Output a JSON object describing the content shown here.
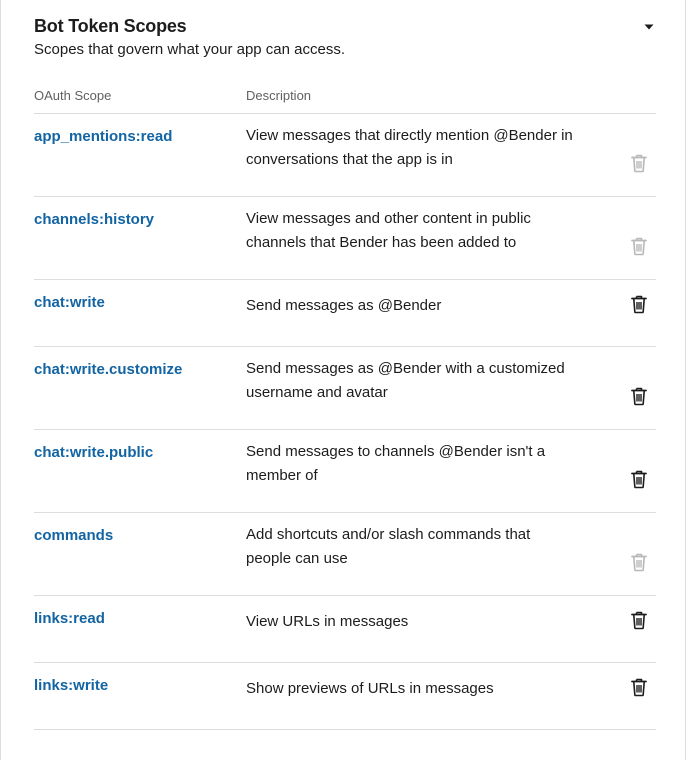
{
  "section": {
    "title": "Bot Token Scopes",
    "subtitle": "Scopes that govern what your app can access."
  },
  "table": {
    "headers": {
      "scope": "OAuth Scope",
      "description": "Description"
    },
    "rows": [
      {
        "scope": "app_mentions:read",
        "description": "View messages that directly mention @Bender in conversations that the app is in",
        "delete_enabled": false
      },
      {
        "scope": "channels:history",
        "description": "View messages and other content in public channels that Bender has been added to",
        "delete_enabled": false
      },
      {
        "scope": "chat:write",
        "description": "Send messages as @Bender",
        "delete_enabled": true
      },
      {
        "scope": "chat:write.customize",
        "description": "Send messages as @Bender with a customized username and avatar",
        "delete_enabled": true
      },
      {
        "scope": "chat:write.public",
        "description": "Send messages to channels @Bender isn't a member of",
        "delete_enabled": true
      },
      {
        "scope": "commands",
        "description": "Add shortcuts and/or slash commands that people can use",
        "delete_enabled": false
      },
      {
        "scope": "links:read",
        "description": "View URLs in messages",
        "delete_enabled": true
      },
      {
        "scope": "links:write",
        "description": "Show previews of URLs in messages",
        "delete_enabled": true
      }
    ]
  },
  "colors": {
    "link": "#1264a3",
    "icon_enabled": "#1d1c1d",
    "icon_disabled": "#b8b8b8",
    "border": "#dddddd"
  },
  "icons": {
    "toggle": "caret-down-icon",
    "delete": "trash-icon"
  }
}
